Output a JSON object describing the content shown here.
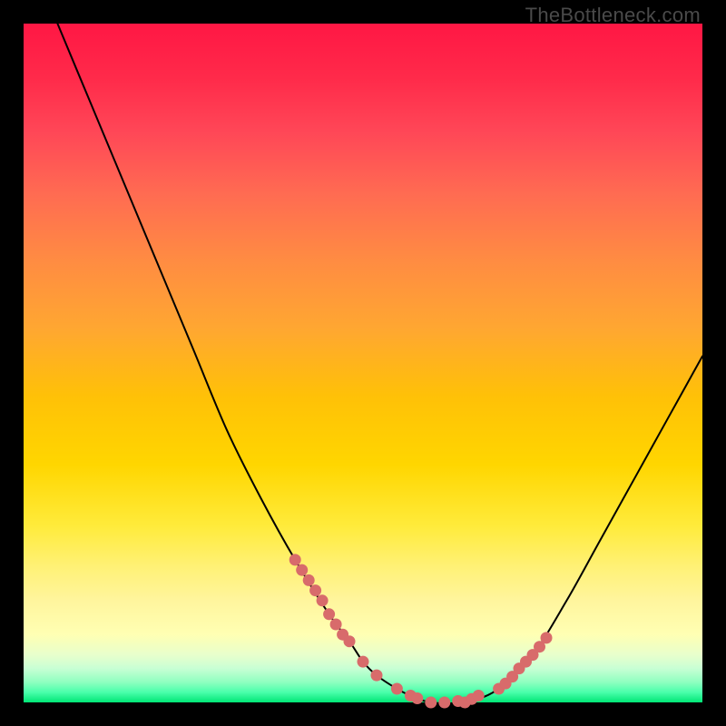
{
  "watermark": "TheBottleneck.com",
  "colors": {
    "page_bg": "#000000",
    "gradient_top": "#ff1744",
    "gradient_bottom": "#00e676",
    "curve_stroke": "#000000",
    "dot_fill": "#d86b6b"
  },
  "chart_data": {
    "type": "line",
    "title": "",
    "xlabel": "",
    "ylabel": "",
    "xlim": [
      0,
      100
    ],
    "ylim": [
      0,
      100
    ],
    "grid": false,
    "legend": false,
    "series": [
      {
        "name": "bottleneck-curve",
        "x": [
          5,
          10,
          15,
          20,
          25,
          30,
          35,
          40,
          45,
          48,
          50,
          52,
          55,
          57,
          60,
          65,
          70,
          75,
          80,
          85,
          90,
          95,
          100
        ],
        "y": [
          100,
          88,
          76,
          64,
          52,
          40,
          30,
          21,
          13,
          9,
          6,
          4,
          2,
          1,
          0,
          0,
          2,
          7,
          15,
          24,
          33,
          42,
          51
        ]
      }
    ],
    "highlight_dots": {
      "name": "highlight-band",
      "x": [
        40,
        41,
        42,
        43,
        44,
        45,
        46,
        47,
        48,
        50,
        52,
        55,
        57,
        58,
        60,
        62,
        64,
        65,
        66,
        67,
        70,
        71,
        72,
        73,
        74,
        75,
        76,
        77
      ],
      "y": [
        21,
        19.5,
        18,
        16.5,
        15,
        13,
        11.5,
        10,
        9,
        6,
        4,
        2,
        1,
        0.6,
        0,
        0,
        0.2,
        0,
        0.5,
        1,
        2,
        2.8,
        3.8,
        5,
        6,
        7,
        8.2,
        9.5
      ]
    }
  }
}
